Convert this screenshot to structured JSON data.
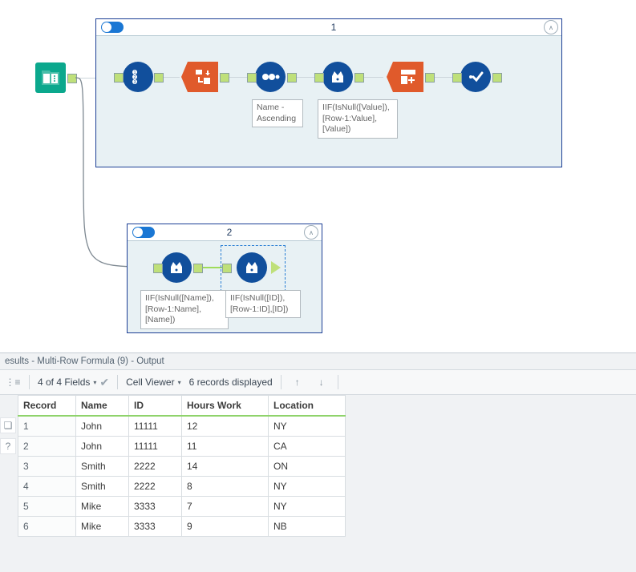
{
  "canvas": {
    "container1_label": "1",
    "container2_label": "2",
    "annot_sort": "Name - Ascending",
    "annot_c1_multirow": "IIF(IsNull([Value]),[Row-1:Value],[Value])",
    "annot_c2_first": "IIF(IsNull([Name]),[Row-1:Name],[Name])",
    "annot_c2_second": "IIF(IsNull([ID]),[Row-1:ID],[ID])"
  },
  "results": {
    "title": "esults - Multi-Row Formula (9) - Output",
    "field_count_button": "4 of 4 Fields",
    "cell_viewer_button": "Cell Viewer",
    "records_label": "6 records displayed",
    "columns": {
      "c0": "Record",
      "c1": "Name",
      "c2": "ID",
      "c3": "Hours Work",
      "c4": "Location"
    },
    "rows": [
      {
        "record": "1",
        "name": "John",
        "id": "11111",
        "hours": "12",
        "loc": "NY"
      },
      {
        "record": "2",
        "name": "John",
        "id": "11111",
        "hours": "11",
        "loc": "CA"
      },
      {
        "record": "3",
        "name": "Smith",
        "id": "2222",
        "hours": "14",
        "loc": "ON"
      },
      {
        "record": "4",
        "name": "Smith",
        "id": "2222",
        "hours": "8",
        "loc": "NY"
      },
      {
        "record": "5",
        "name": "Mike",
        "id": "3333",
        "hours": "7",
        "loc": "NY"
      },
      {
        "record": "6",
        "name": "Mike",
        "id": "3333",
        "hours": "9",
        "loc": "NB"
      }
    ]
  }
}
